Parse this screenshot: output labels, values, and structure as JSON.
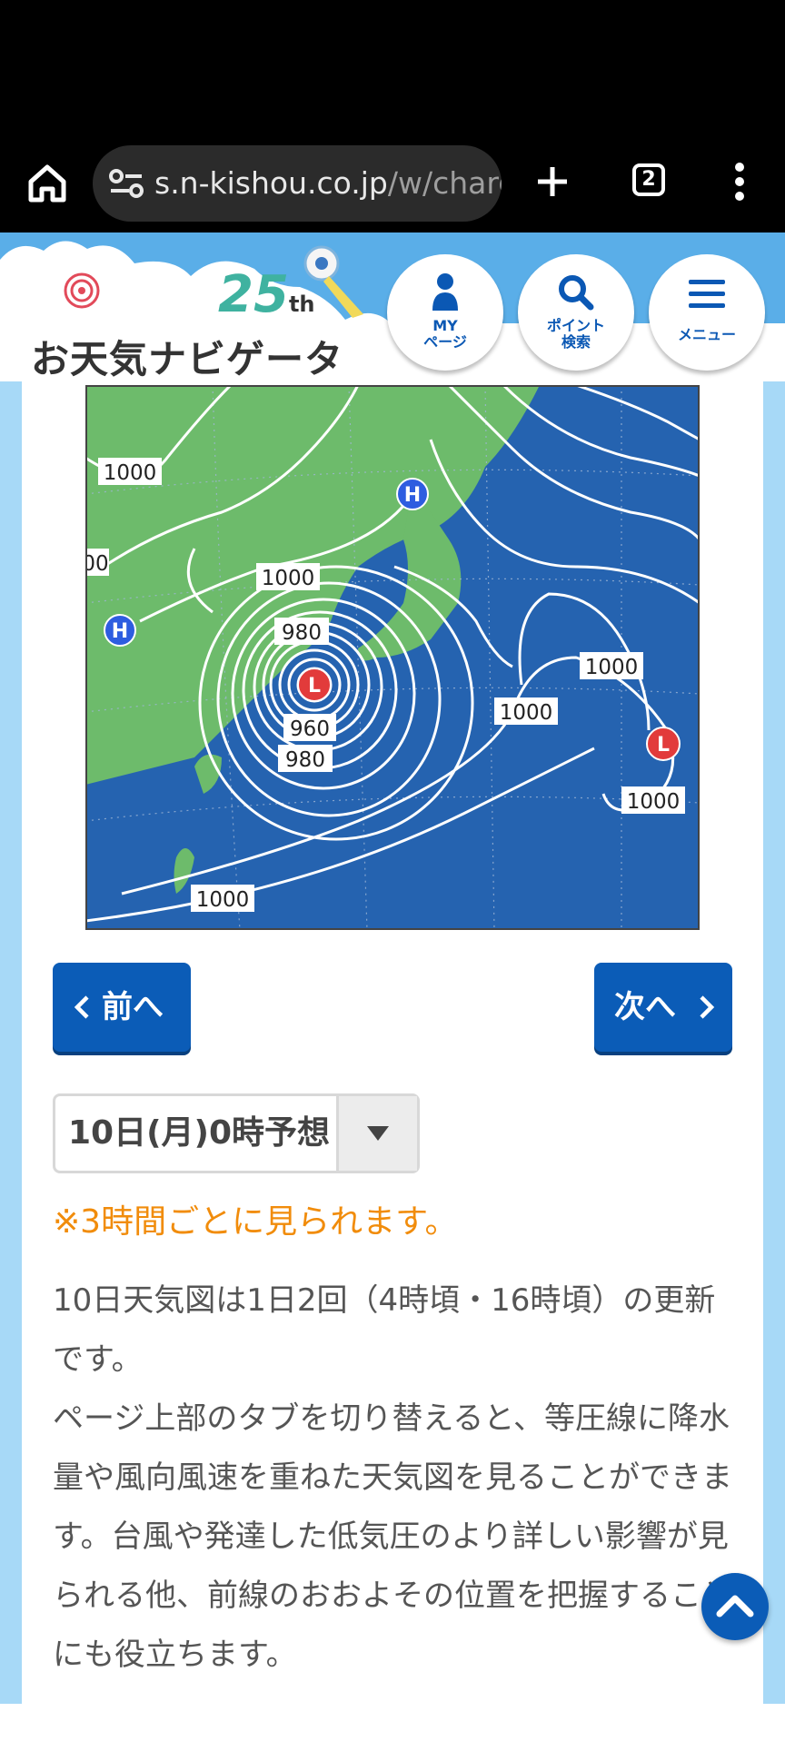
{
  "browser": {
    "url_domain": "s.n-kishou.co.jp",
    "url_path": "/w/charg",
    "tab_count": "2",
    "icons": [
      "home-icon",
      "site-info-icon",
      "plus-icon",
      "tabs-icon",
      "more-vert-icon"
    ]
  },
  "site": {
    "logo_text": "お天気ナビゲータ",
    "anniversary_number": "25",
    "anniversary_suffix": "th",
    "buttons": {
      "my_line1": "MY",
      "my_line2": "ページ",
      "point_line1": "ポイント",
      "point_line2": "検索",
      "menu": "メニュー"
    },
    "colors": {
      "brand_blue": "#0b5cb7",
      "sky": "#5aaee8",
      "note_orange": "#f18c0b"
    }
  },
  "weather_map": {
    "isobar_labels": [
      "1000",
      "00",
      "1000",
      "980",
      "960",
      "980",
      "1000",
      "1000",
      "1000",
      "1000"
    ],
    "high_label": "H",
    "low_label": "L"
  },
  "nav": {
    "prev_label": "前へ",
    "next_label": "次へ"
  },
  "forecast_select": {
    "selected": "10日(月)0時予想"
  },
  "note": "※3時間ごとに見られます。",
  "description": [
    "10日天気図は1日2回（4時頃・16時頃）の更新です。",
    "ページ上部のタブを切り替えると、等圧線に降水量や風向風速を重ねた天気図を見ることができます。台風や発達した低気圧のより詳しい影響が見られる他、前線のおおよその位置を把握することにも役立ちます。"
  ]
}
